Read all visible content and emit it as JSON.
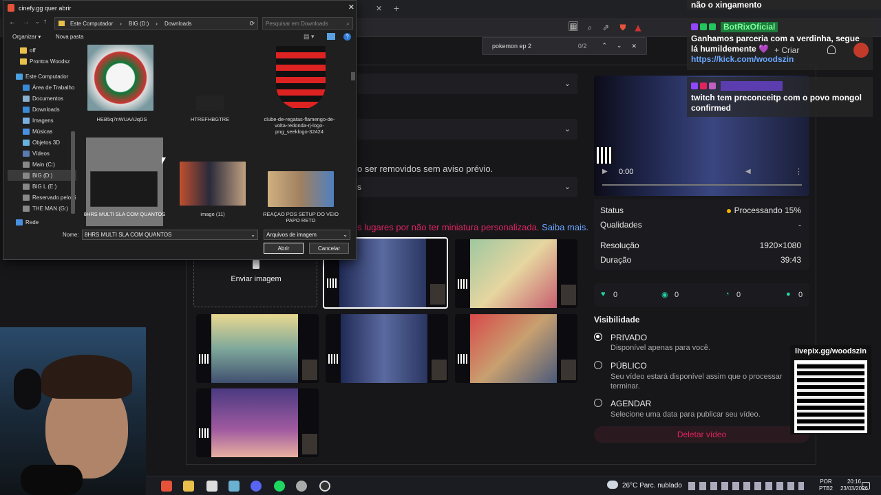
{
  "browser": {
    "find_query": "pokemon ep 2",
    "find_count": "0/2",
    "warning_text": "o ser removidos sem aviso prévio.",
    "dropdown_fragment": "s",
    "thumb_note": "s lugares por não ter miniatura personalizada.",
    "learn_more": "Saiba mais.",
    "upload_image": "Enviar imagem"
  },
  "video_panel": {
    "time": "0:00",
    "status_label": "Status",
    "status_value": "Processando 15%",
    "qualities_label": "Qualidades",
    "qualities_value": "-",
    "resolution_label": "Resolução",
    "resolution_value": "1920×1080",
    "duration_label": "Duração",
    "duration_value": "39:43",
    "stats": [
      "0",
      "0",
      "0",
      "0"
    ]
  },
  "visibility": {
    "title": "Visibilidade",
    "options": [
      {
        "label": "PRIVADO",
        "desc": "Disponível apenas para você."
      },
      {
        "label": "PÚBLICO",
        "desc": "Seu vídeo estará disponível assim que o processar",
        "desc2": "terminar."
      },
      {
        "label": "AGENDAR",
        "desc": "Selecione uma data para publicar seu vídeo."
      }
    ],
    "delete": "Deletar vídeo"
  },
  "dialog": {
    "title": "cinefy.gg quer abrir",
    "path": [
      "Este Computador",
      "BIG (D:)",
      "Downloads"
    ],
    "search_placeholder": "Pesquisar em Downloads",
    "organize": "Organizar ▾",
    "new_folder": "Nova pasta",
    "nav": [
      "off",
      "Prontos Woodsz",
      "Este Computador",
      "Área de Trabalho",
      "Documentos",
      "Downloads",
      "Imagens",
      "Músicas",
      "Objetos 3D",
      "Vídeos",
      "Main (C:)",
      "BIG (D:)",
      "BIG L  (E:)",
      "Reservado pelo Sistema",
      "THE MAN  (G:)",
      "Rede"
    ],
    "files": [
      {
        "name": "HEB5q7nWUAAJqDS"
      },
      {
        "name": "HTREFHBGTRE"
      },
      {
        "name": "clube-de-regatas-flamengo-de-volta-redonda-rj-logo-png_seeklogo-32424"
      },
      {
        "name": "8HRS MULTI SLA COM QUANTOS"
      },
      {
        "name": "image (11)"
      },
      {
        "name": "REAÇAO POS SETUP DO VEIO PAPO RETO"
      }
    ],
    "name_label": "Nome:",
    "name_value": "8HRS MULTI SLA COM QUANTOS",
    "filter": "Arquivos de imagem",
    "open": "Abrir",
    "cancel": "Cancelar"
  },
  "chat": {
    "top": "não o xingamento",
    "user1": "BotRixOficial",
    "msg1": "Ganhamos parceria com a verdinha, segue lá humildemente 💜",
    "link1": "https://kick.com/woodszin",
    "create": "+ Criar",
    "msg2": "twitch tem preconceitp com o povo mongol confirmed"
  },
  "livepix": "livepix.gg/woodszin",
  "taskbar": {
    "weather": "26°C  Parc. nublado",
    "lang1": "POR",
    "lang2": "PTB2",
    "time": "20:16",
    "date": "23/03/2026"
  },
  "colors": {
    "accent": "#22d3a4",
    "danger": "#e0245e",
    "link": "#6aa7ff",
    "processing": "#f5b400"
  }
}
